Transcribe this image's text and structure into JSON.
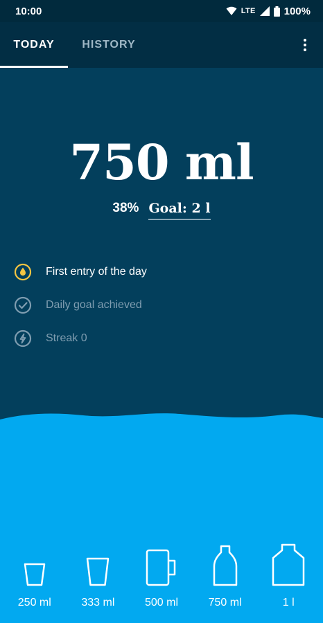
{
  "status_bar": {
    "time": "10:00",
    "network": "LTE",
    "battery": "100%"
  },
  "tabs": [
    {
      "label": "TODAY"
    },
    {
      "label": "HISTORY"
    }
  ],
  "summary": {
    "amount": "750 ml",
    "percent": "38%",
    "goal": "Goal: 2 l",
    "progress_fraction": 0.38
  },
  "achievements": [
    {
      "label": "First entry of the day",
      "icon": "water-drop-icon"
    },
    {
      "label": "Daily goal achieved",
      "icon": "check-circle-icon"
    },
    {
      "label": "Streak 0",
      "icon": "lightning-icon"
    }
  ],
  "cups": [
    {
      "label": "250 ml",
      "icon": "small-glass-icon"
    },
    {
      "label": "333 ml",
      "icon": "glass-icon"
    },
    {
      "label": "500 ml",
      "icon": "mug-icon"
    },
    {
      "label": "750 ml",
      "icon": "bottle-icon"
    },
    {
      "label": "1 l",
      "icon": "jug-icon"
    }
  ],
  "colors": {
    "background": "#033f5c",
    "toolbar": "#022e44",
    "water": "#02a9f0",
    "accent_yellow": "#f5c542"
  }
}
